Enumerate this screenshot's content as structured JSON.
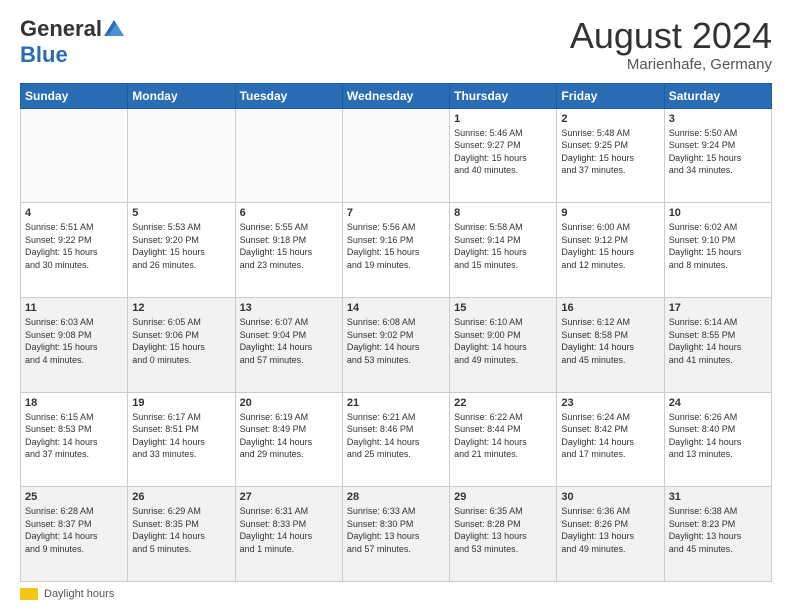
{
  "header": {
    "logo_general": "General",
    "logo_blue": "Blue",
    "month_title": "August 2024",
    "location": "Marienhafe, Germany"
  },
  "footer": {
    "daylight_label": "Daylight hours"
  },
  "days_of_week": [
    "Sunday",
    "Monday",
    "Tuesday",
    "Wednesday",
    "Thursday",
    "Friday",
    "Saturday"
  ],
  "weeks": [
    [
      {
        "day": "",
        "info": "",
        "empty": true
      },
      {
        "day": "",
        "info": "",
        "empty": true
      },
      {
        "day": "",
        "info": "",
        "empty": true
      },
      {
        "day": "",
        "info": "",
        "empty": true
      },
      {
        "day": "1",
        "info": "Sunrise: 5:46 AM\nSunset: 9:27 PM\nDaylight: 15 hours\nand 40 minutes."
      },
      {
        "day": "2",
        "info": "Sunrise: 5:48 AM\nSunset: 9:25 PM\nDaylight: 15 hours\nand 37 minutes."
      },
      {
        "day": "3",
        "info": "Sunrise: 5:50 AM\nSunset: 9:24 PM\nDaylight: 15 hours\nand 34 minutes."
      }
    ],
    [
      {
        "day": "4",
        "info": "Sunrise: 5:51 AM\nSunset: 9:22 PM\nDaylight: 15 hours\nand 30 minutes."
      },
      {
        "day": "5",
        "info": "Sunrise: 5:53 AM\nSunset: 9:20 PM\nDaylight: 15 hours\nand 26 minutes."
      },
      {
        "day": "6",
        "info": "Sunrise: 5:55 AM\nSunset: 9:18 PM\nDaylight: 15 hours\nand 23 minutes."
      },
      {
        "day": "7",
        "info": "Sunrise: 5:56 AM\nSunset: 9:16 PM\nDaylight: 15 hours\nand 19 minutes."
      },
      {
        "day": "8",
        "info": "Sunrise: 5:58 AM\nSunset: 9:14 PM\nDaylight: 15 hours\nand 15 minutes."
      },
      {
        "day": "9",
        "info": "Sunrise: 6:00 AM\nSunset: 9:12 PM\nDaylight: 15 hours\nand 12 minutes."
      },
      {
        "day": "10",
        "info": "Sunrise: 6:02 AM\nSunset: 9:10 PM\nDaylight: 15 hours\nand 8 minutes."
      }
    ],
    [
      {
        "day": "11",
        "info": "Sunrise: 6:03 AM\nSunset: 9:08 PM\nDaylight: 15 hours\nand 4 minutes."
      },
      {
        "day": "12",
        "info": "Sunrise: 6:05 AM\nSunset: 9:06 PM\nDaylight: 15 hours\nand 0 minutes."
      },
      {
        "day": "13",
        "info": "Sunrise: 6:07 AM\nSunset: 9:04 PM\nDaylight: 14 hours\nand 57 minutes."
      },
      {
        "day": "14",
        "info": "Sunrise: 6:08 AM\nSunset: 9:02 PM\nDaylight: 14 hours\nand 53 minutes."
      },
      {
        "day": "15",
        "info": "Sunrise: 6:10 AM\nSunset: 9:00 PM\nDaylight: 14 hours\nand 49 minutes."
      },
      {
        "day": "16",
        "info": "Sunrise: 6:12 AM\nSunset: 8:58 PM\nDaylight: 14 hours\nand 45 minutes."
      },
      {
        "day": "17",
        "info": "Sunrise: 6:14 AM\nSunset: 8:55 PM\nDaylight: 14 hours\nand 41 minutes."
      }
    ],
    [
      {
        "day": "18",
        "info": "Sunrise: 6:15 AM\nSunset: 8:53 PM\nDaylight: 14 hours\nand 37 minutes."
      },
      {
        "day": "19",
        "info": "Sunrise: 6:17 AM\nSunset: 8:51 PM\nDaylight: 14 hours\nand 33 minutes."
      },
      {
        "day": "20",
        "info": "Sunrise: 6:19 AM\nSunset: 8:49 PM\nDaylight: 14 hours\nand 29 minutes."
      },
      {
        "day": "21",
        "info": "Sunrise: 6:21 AM\nSunset: 8:46 PM\nDaylight: 14 hours\nand 25 minutes."
      },
      {
        "day": "22",
        "info": "Sunrise: 6:22 AM\nSunset: 8:44 PM\nDaylight: 14 hours\nand 21 minutes."
      },
      {
        "day": "23",
        "info": "Sunrise: 6:24 AM\nSunset: 8:42 PM\nDaylight: 14 hours\nand 17 minutes."
      },
      {
        "day": "24",
        "info": "Sunrise: 6:26 AM\nSunset: 8:40 PM\nDaylight: 14 hours\nand 13 minutes."
      }
    ],
    [
      {
        "day": "25",
        "info": "Sunrise: 6:28 AM\nSunset: 8:37 PM\nDaylight: 14 hours\nand 9 minutes."
      },
      {
        "day": "26",
        "info": "Sunrise: 6:29 AM\nSunset: 8:35 PM\nDaylight: 14 hours\nand 5 minutes."
      },
      {
        "day": "27",
        "info": "Sunrise: 6:31 AM\nSunset: 8:33 PM\nDaylight: 14 hours\nand 1 minute."
      },
      {
        "day": "28",
        "info": "Sunrise: 6:33 AM\nSunset: 8:30 PM\nDaylight: 13 hours\nand 57 minutes."
      },
      {
        "day": "29",
        "info": "Sunrise: 6:35 AM\nSunset: 8:28 PM\nDaylight: 13 hours\nand 53 minutes."
      },
      {
        "day": "30",
        "info": "Sunrise: 6:36 AM\nSunset: 8:26 PM\nDaylight: 13 hours\nand 49 minutes."
      },
      {
        "day": "31",
        "info": "Sunrise: 6:38 AM\nSunset: 8:23 PM\nDaylight: 13 hours\nand 45 minutes."
      }
    ]
  ]
}
